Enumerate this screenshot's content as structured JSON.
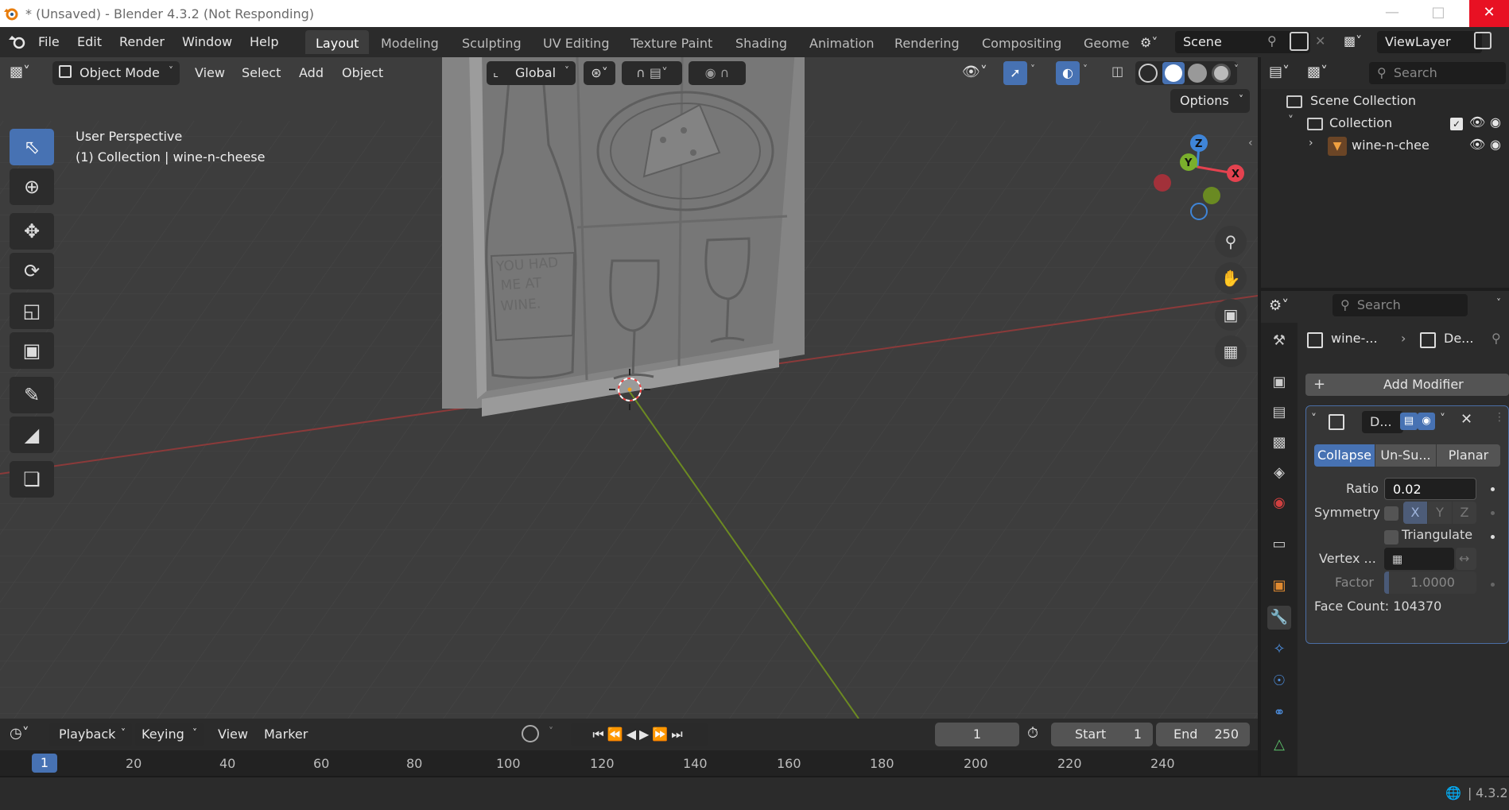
{
  "window": {
    "title": "* (Unsaved) - Blender 4.3.2 (Not Responding)",
    "minimize_icon": "minimize-icon",
    "maximize_icon": "maximize-icon",
    "close_icon": "close-icon"
  },
  "menu": [
    "File",
    "Edit",
    "Render",
    "Window",
    "Help"
  ],
  "workspaces": [
    "Layout",
    "Modeling",
    "Sculpting",
    "UV Editing",
    "Texture Paint",
    "Shading",
    "Animation",
    "Rendering",
    "Compositing",
    "Geome"
  ],
  "scene": {
    "name": "Scene",
    "view_layer": "ViewLayer"
  },
  "viewport_header": {
    "mode": "Object Mode",
    "menus": [
      "View",
      "Select",
      "Add",
      "Object"
    ],
    "orientation": "Global",
    "options_label": "Options"
  },
  "viewport": {
    "perspective_label": "User Perspective",
    "collection_label": "(1) Collection | wine-n-cheese",
    "gizmo_labels": {
      "x": "X",
      "y": "Y",
      "z": "Z"
    },
    "model_text": "YOU HAD ME AT WINE."
  },
  "toolbar_icons": [
    "select-box-icon",
    "cursor-icon",
    "move-icon",
    "rotate-icon",
    "scale-icon",
    "transform-icon",
    "annotate-icon",
    "measure-icon",
    "add-cube-icon"
  ],
  "timeline": {
    "menus": [
      "Playback",
      "Keying",
      "View",
      "Marker"
    ],
    "current_frame": "1",
    "start_label": "Start",
    "start_value": "1",
    "end_label": "End",
    "end_value": "250",
    "ruler": [
      "1",
      "20",
      "40",
      "60",
      "80",
      "100",
      "120",
      "140",
      "160",
      "180",
      "200",
      "220",
      "240"
    ]
  },
  "outliner": {
    "search_placeholder": "Search",
    "items": [
      "Scene Collection",
      "Collection",
      "wine-n-chee"
    ]
  },
  "properties": {
    "search_placeholder": "Search",
    "breadcrumb_object": "wine-...",
    "breadcrumb_modifier": "De...",
    "add_modifier_label": "Add Modifier",
    "modifier_name": "D...",
    "modes": [
      "Collapse",
      "Un-Su...",
      "Planar"
    ],
    "ratio_label": "Ratio",
    "ratio_value": "0.02",
    "symmetry_label": "Symmetry",
    "axes": [
      "X",
      "Y",
      "Z"
    ],
    "triangulate_label": "Triangulate",
    "vertex_label": "Vertex ...",
    "factor_label": "Factor",
    "factor_value": "1.0000",
    "face_count": "Face Count: 104370"
  },
  "status": {
    "version": "4.3.2"
  },
  "colors": {
    "accent": "#4772b3",
    "viewport_bg": "#3d3d3d",
    "panel_bg": "#2b2b2b",
    "x_axis": "#e4424f",
    "y_axis": "#7aaf2c",
    "z_axis": "#3f85d8"
  }
}
